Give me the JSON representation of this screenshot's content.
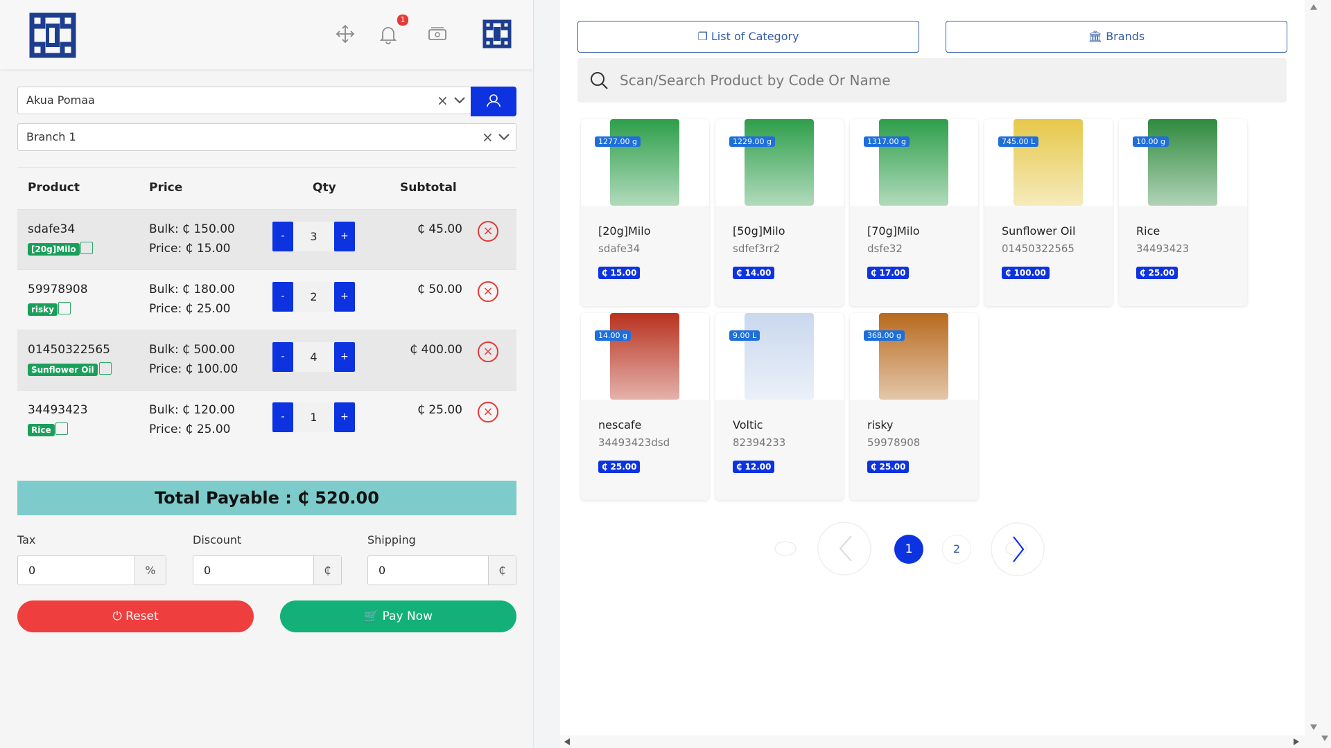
{
  "header": {
    "notification_count": "1",
    "icons": [
      "move-icon",
      "bell-icon",
      "cash-icon"
    ]
  },
  "customer_select": {
    "value": "Akua Pomaa"
  },
  "branch_select": {
    "value": "Branch 1"
  },
  "cart": {
    "headers": {
      "product": "Product",
      "price": "Price",
      "qty": "Qty",
      "subtotal": "Subtotal"
    },
    "rows": [
      {
        "code": "sdafe34",
        "tag": "[20g]Milo",
        "bulk": "Bulk: ₵ 150.00",
        "price": "Price: ₵ 15.00",
        "qty": "3",
        "subtotal": "₵ 45.00"
      },
      {
        "code": "59978908",
        "tag": "risky",
        "bulk": "Bulk: ₵ 180.00",
        "price": "Price: ₵ 25.00",
        "qty": "2",
        "subtotal": "₵ 50.00"
      },
      {
        "code": "01450322565",
        "tag": "Sunflower Oil",
        "bulk": "Bulk: ₵ 500.00",
        "price": "Price: ₵ 100.00",
        "qty": "4",
        "subtotal": "₵ 400.00"
      },
      {
        "code": "34493423",
        "tag": "Rice",
        "bulk": "Bulk: ₵ 120.00",
        "price": "Price: ₵ 25.00",
        "qty": "1",
        "subtotal": "₵ 25.00"
      }
    ],
    "minus_label": "-",
    "plus_label": "+"
  },
  "total": "Total Payable : ₵ 520.00",
  "fields": {
    "tax": {
      "label": "Tax",
      "value": "0",
      "unit": "%"
    },
    "discount": {
      "label": "Discount",
      "value": "0",
      "unit": "₵"
    },
    "shipping": {
      "label": "Shipping",
      "value": "0",
      "unit": "₵"
    }
  },
  "actions": {
    "reset": "Reset",
    "pay": "Pay Now"
  },
  "catalog": {
    "category_button": "List of Category",
    "brands_button": "Brands",
    "search_placeholder": "Scan/Search Product by Code Or Name",
    "products": [
      {
        "name": "[20g]Milo",
        "code": "sdafe34",
        "weight": "1277.00 g",
        "price": "₵ 15.00",
        "color": "#2e9e4a"
      },
      {
        "name": "[50g]Milo",
        "code": "sdfef3rr2",
        "weight": "1229.00 g",
        "price": "₵ 14.00",
        "color": "#2e9e4a"
      },
      {
        "name": "[70g]Milo",
        "code": "dsfe32",
        "weight": "1317.00 g",
        "price": "₵ 17.00",
        "color": "#2e9e4a"
      },
      {
        "name": "Sunflower Oil",
        "code": "01450322565",
        "weight": "745.00 L",
        "price": "₵ 100.00",
        "color": "#e6c84a"
      },
      {
        "name": "Rice",
        "code": "34493423",
        "weight": "10.00 g",
        "price": "₵ 25.00",
        "color": "#2f8a3e"
      },
      {
        "name": "nescafe",
        "code": "34493423dsd",
        "weight": "14.00 g",
        "price": "₵ 25.00",
        "color": "#b8321f"
      },
      {
        "name": "Voltic",
        "code": "82394233",
        "weight": "9.00 L",
        "price": "₵ 12.00",
        "color": "#c9d8ee"
      },
      {
        "name": "risky",
        "code": "59978908",
        "weight": "368.00 g",
        "price": "₵ 25.00",
        "color": "#b86a1e"
      }
    ]
  },
  "pagination": {
    "pages": [
      "1",
      "2"
    ],
    "current": "1"
  },
  "colors": {
    "primary": "#0d33e0",
    "danger": "#ef3e3e",
    "success": "#14b07a",
    "total_bg": "#7ecbcb"
  }
}
